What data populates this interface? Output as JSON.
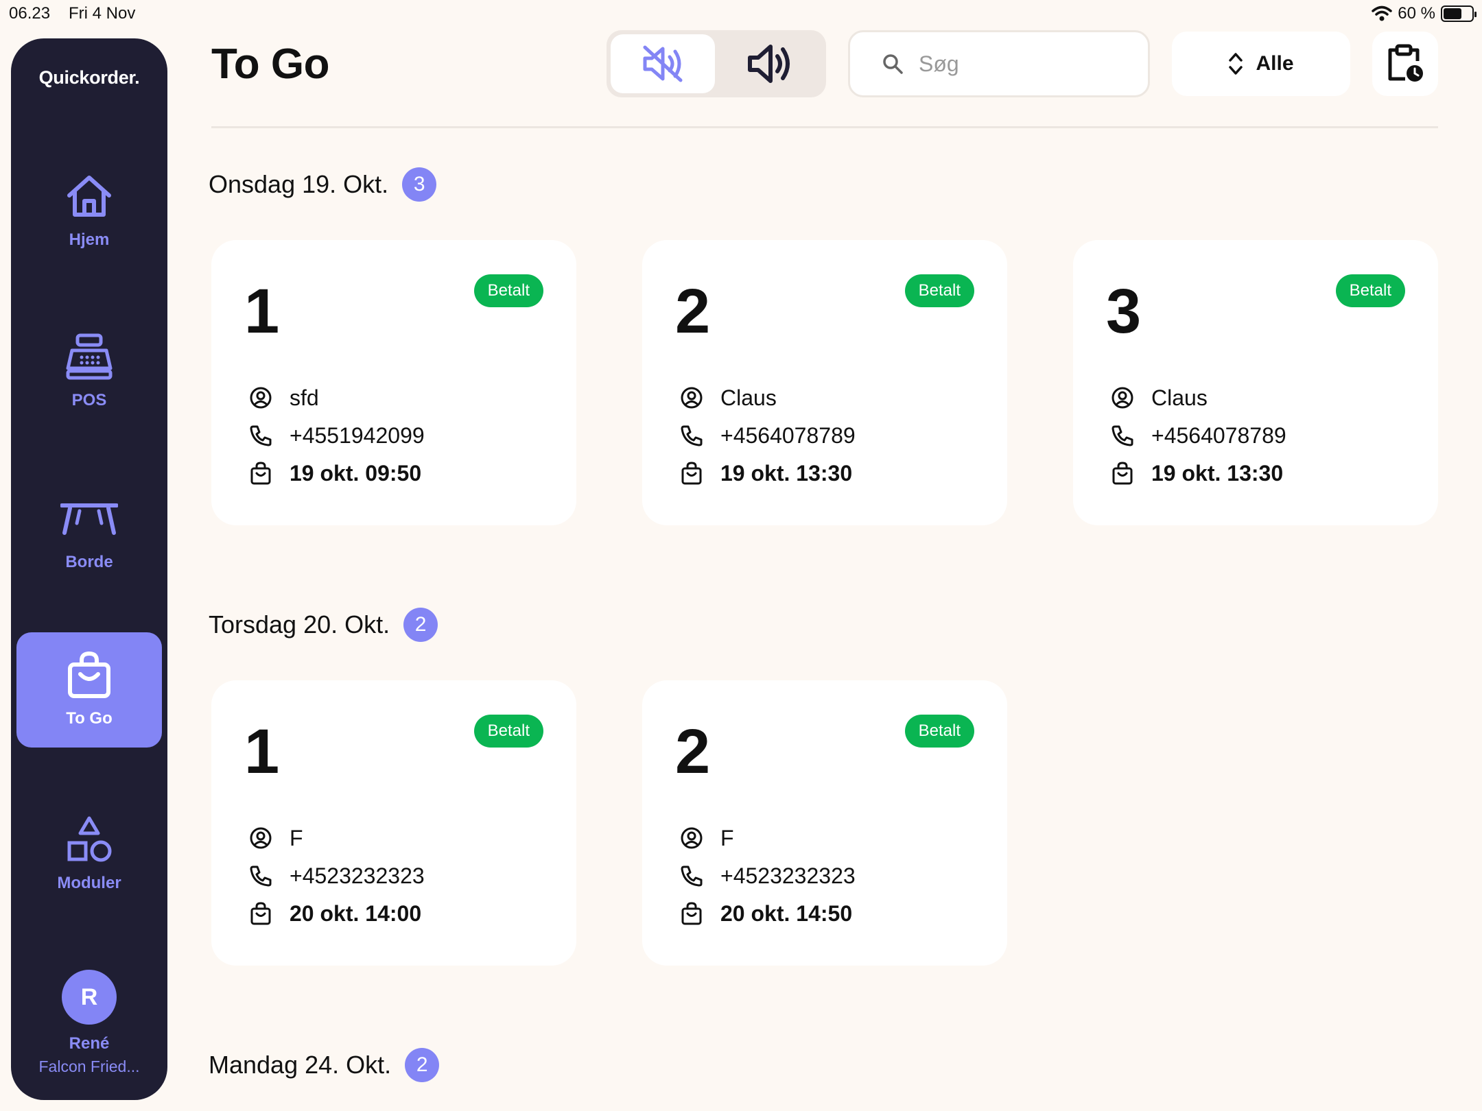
{
  "status_bar": {
    "time": "06.23",
    "date": "Fri 4 Nov",
    "battery": "60 %",
    "battery_level": 0.6
  },
  "sidebar": {
    "logo": "Quickorder.",
    "items": [
      {
        "label": "Hjem",
        "icon": "home-icon"
      },
      {
        "label": "POS",
        "icon": "cash-register-icon"
      },
      {
        "label": "Borde",
        "icon": "table-icon"
      },
      {
        "label": "To Go",
        "icon": "shopping-bag-icon",
        "active": true
      },
      {
        "label": "Moduler",
        "icon": "modules-icon"
      }
    ],
    "user": {
      "initial": "R",
      "name": "René",
      "org": "Falcon Fried..."
    }
  },
  "header": {
    "title": "To Go",
    "sound": {
      "mute_icon": "speaker-muted-icon",
      "on_icon": "speaker-on-icon",
      "selected": "mute"
    },
    "search": {
      "placeholder": "Søg",
      "value": ""
    },
    "filter": {
      "label": "Alle",
      "icon": "sort-icon"
    },
    "schedule_icon": "clipboard-clock-icon"
  },
  "colors": {
    "accent": "#8385f5",
    "sidebar": "#1f1e33",
    "paid": "#0ab552",
    "background": "#fdf8f3"
  },
  "sections": [
    {
      "title": "Onsdag 19. Okt.",
      "count": "3",
      "orders": [
        {
          "number": "1",
          "status": "Betalt",
          "name": "sfd",
          "phone": "+4551942099",
          "pickup": "19 okt. 09:50"
        },
        {
          "number": "2",
          "status": "Betalt",
          "name": "Claus",
          "phone": "+4564078789",
          "pickup": "19 okt. 13:30"
        },
        {
          "number": "3",
          "status": "Betalt",
          "name": "Claus",
          "phone": "+4564078789",
          "pickup": "19 okt. 13:30"
        }
      ]
    },
    {
      "title": "Torsdag 20. Okt.",
      "count": "2",
      "orders": [
        {
          "number": "1",
          "status": "Betalt",
          "name": "F",
          "phone": "+4523232323",
          "pickup": "20 okt. 14:00"
        },
        {
          "number": "2",
          "status": "Betalt",
          "name": "F",
          "phone": "+4523232323",
          "pickup": "20 okt. 14:50"
        }
      ]
    },
    {
      "title": "Mandag 24. Okt.",
      "count": "2",
      "orders": []
    }
  ]
}
